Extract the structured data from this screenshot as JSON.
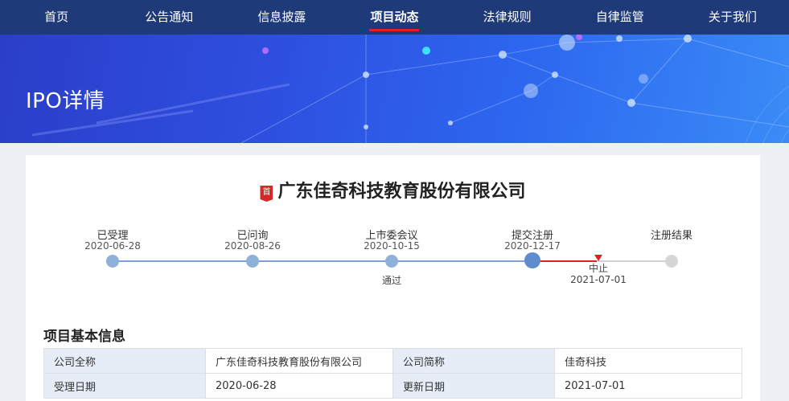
{
  "nav": {
    "items": [
      {
        "label": "首页"
      },
      {
        "label": "公告通知"
      },
      {
        "label": "信息披露"
      },
      {
        "label": "项目动态"
      },
      {
        "label": "法律规则"
      },
      {
        "label": "自律监管"
      },
      {
        "label": "关于我们"
      }
    ],
    "active_index": 3
  },
  "banner": {
    "title": "IPO详情"
  },
  "company": {
    "badge": "首",
    "name": "广东佳奇科技教育股份有限公司"
  },
  "timeline": {
    "steps": [
      {
        "name": "已受理",
        "date": "2020-06-28",
        "sub": ""
      },
      {
        "name": "已问询",
        "date": "2020-08-26",
        "sub": ""
      },
      {
        "name": "上市委会议",
        "date": "2020-10-15",
        "sub": "通过"
      },
      {
        "name": "提交注册",
        "date": "2020-12-17",
        "sub": ""
      },
      {
        "name": "注册结果",
        "date": "",
        "sub": ""
      }
    ],
    "stop": {
      "label": "中止",
      "date": "2021-07-01"
    }
  },
  "info": {
    "title": "项目基本信息",
    "rows": [
      {
        "l1": "公司全称",
        "v1": "广东佳奇科技教育股份有限公司",
        "l2": "公司简称",
        "v2": "佳奇科技"
      },
      {
        "l1": "受理日期",
        "v1": "2020-06-28",
        "l2": "更新日期",
        "v2": "2021-07-01"
      }
    ]
  },
  "colors": {
    "nav_bg": "#1e3a78",
    "accent_red": "#e02020",
    "progress_blue": "#7ea2cf"
  }
}
